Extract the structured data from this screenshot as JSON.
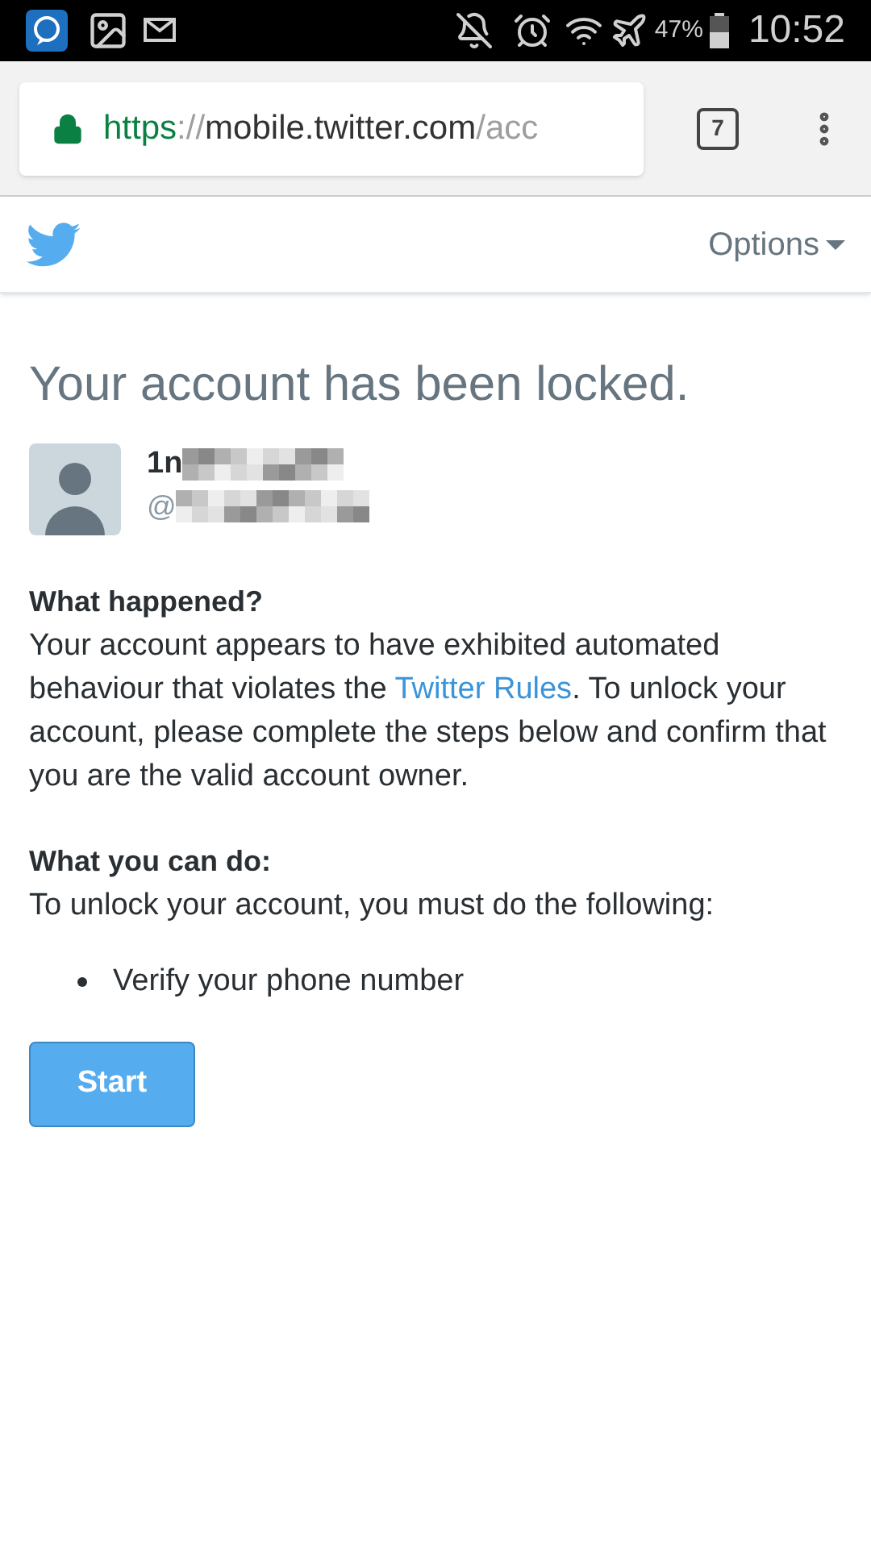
{
  "status_bar": {
    "battery": "47%",
    "time": "10:52"
  },
  "browser": {
    "url_scheme": "https",
    "url_separator": "://",
    "url_host": "mobile.twitter.com",
    "url_path": "/acc",
    "tab_count": "7"
  },
  "header": {
    "options_label": "Options"
  },
  "title": "Your account has been locked.",
  "account": {
    "name": "1n",
    "handle": "@"
  },
  "sections": [
    {
      "heading": "What happened?",
      "body_before": "Your account appears to have exhibited automated behaviour that violates the ",
      "link": "Twitter Rules",
      "body_after": ". To unlock your account, please complete the steps below and confirm that you are the valid account owner."
    },
    {
      "heading": "What you can do:",
      "body_before": "To unlock your account, you must do the following:"
    }
  ],
  "steps": [
    "Verify your phone number"
  ],
  "start_button": "Start"
}
